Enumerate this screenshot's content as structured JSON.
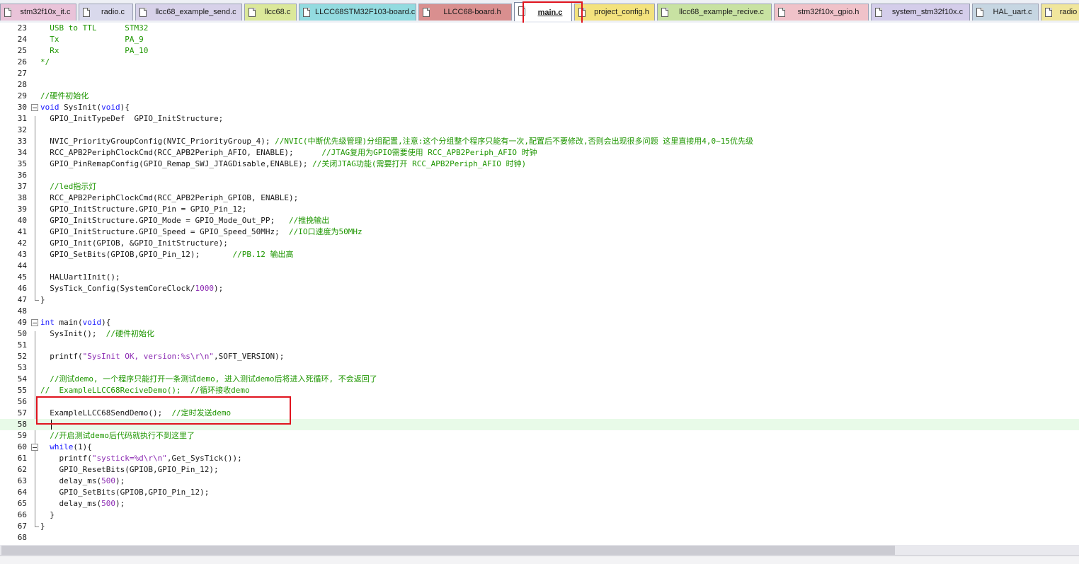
{
  "tabs": [
    {
      "label": "stm32f10x_it.c",
      "color": "#e9c3d9"
    },
    {
      "label": "radio.c",
      "color": "#d9d9ec"
    },
    {
      "label": "llcc68_example_send.c",
      "color": "#d7d1e9"
    },
    {
      "label": "llcc68.c",
      "color": "#dbe89a"
    },
    {
      "label": "LLCC68STM32F103-board.c",
      "color": "#93dbe0"
    },
    {
      "label": "LLCC68-board.h",
      "color": "#d98f8f"
    },
    {
      "label": "main.c",
      "color": "#ffffff",
      "active": true
    },
    {
      "label": "project_config.h",
      "color": "#f3e27d"
    },
    {
      "label": "llcc68_example_recive.c",
      "color": "#c8e2a2"
    },
    {
      "label": "stm32f10x_gpio.h",
      "color": "#f0c2c9"
    },
    {
      "label": "system_stm32f10x.c",
      "color": "#d4cdea"
    },
    {
      "label": "HAL_uart.c",
      "color": "#c6d6e2"
    },
    {
      "label": "radio",
      "color": "#f0e69c"
    }
  ],
  "editor": {
    "current_line": 58,
    "lines": [
      {
        "n": "23",
        "tokens": [
          {
            "t": "  USB to TTL      STM32",
            "c": "cm"
          }
        ]
      },
      {
        "n": "24",
        "tokens": [
          {
            "t": "  Tx              PA_9",
            "c": "cm"
          }
        ]
      },
      {
        "n": "25",
        "tokens": [
          {
            "t": "  Rx              PA_10",
            "c": "cm"
          }
        ]
      },
      {
        "n": "26",
        "tokens": [
          {
            "t": "*/",
            "c": "cm"
          }
        ]
      },
      {
        "n": "27",
        "tokens": []
      },
      {
        "n": "28",
        "tokens": []
      },
      {
        "n": "29",
        "tokens": [
          {
            "t": "//硬件初始化",
            "c": "cm"
          }
        ]
      },
      {
        "n": "30",
        "fold": true,
        "tokens": [
          {
            "t": "void",
            "c": "kw"
          },
          {
            "t": " SysInit(",
            "c": "tx"
          },
          {
            "t": "void",
            "c": "kw"
          },
          {
            "t": "){",
            "c": "tx"
          }
        ]
      },
      {
        "n": "31",
        "tokens": [
          {
            "t": "  GPIO_InitTypeDef  GPIO_InitStructure;",
            "c": "tx"
          }
        ]
      },
      {
        "n": "32",
        "tokens": []
      },
      {
        "n": "33",
        "tokens": [
          {
            "t": "  NVIC_PriorityGroupConfig(NVIC_PriorityGroup_4); ",
            "c": "tx"
          },
          {
            "t": "//NVIC(中断优先级管理)分组配置,注意:这个分组整个程序只能有一次,配置后不要修改,否则会出现很多问题 这里直接用4,0~15优先级",
            "c": "cm"
          }
        ]
      },
      {
        "n": "34",
        "tokens": [
          {
            "t": "  RCC_APB2PeriphClockCmd(RCC_APB2Periph_AFIO, ENABLE);      ",
            "c": "tx"
          },
          {
            "t": "//JTAG复用为GPIO需要使用 RCC_APB2Periph_AFIO 时钟",
            "c": "cm"
          }
        ]
      },
      {
        "n": "35",
        "tokens": [
          {
            "t": "  GPIO_PinRemapConfig(GPIO_Remap_SWJ_JTAGDisable,ENABLE); ",
            "c": "tx"
          },
          {
            "t": "//关闭JTAG功能(需要打开 RCC_APB2Periph_AFIO 时钟)",
            "c": "cm"
          }
        ]
      },
      {
        "n": "36",
        "tokens": []
      },
      {
        "n": "37",
        "tokens": [
          {
            "t": "  //led指示灯",
            "c": "cm"
          }
        ]
      },
      {
        "n": "38",
        "tokens": [
          {
            "t": "  RCC_APB2PeriphClockCmd(RCC_APB2Periph_GPIOB, ENABLE);",
            "c": "tx"
          }
        ]
      },
      {
        "n": "39",
        "tokens": [
          {
            "t": "  GPIO_InitStructure.GPIO_Pin = GPIO_Pin_12;",
            "c": "tx"
          }
        ]
      },
      {
        "n": "40",
        "tokens": [
          {
            "t": "  GPIO_InitStructure.GPIO_Mode = GPIO_Mode_Out_PP;   ",
            "c": "tx"
          },
          {
            "t": "//推挽输出",
            "c": "cm"
          }
        ]
      },
      {
        "n": "41",
        "tokens": [
          {
            "t": "  GPIO_InitStructure.GPIO_Speed = GPIO_Speed_50MHz;  ",
            "c": "tx"
          },
          {
            "t": "//IO口速度为50MHz",
            "c": "cm"
          }
        ]
      },
      {
        "n": "42",
        "tokens": [
          {
            "t": "  GPIO_Init(GPIOB, &GPIO_InitStructure);",
            "c": "tx"
          }
        ]
      },
      {
        "n": "43",
        "tokens": [
          {
            "t": "  GPIO_SetBits(GPIOB,GPIO_Pin_12);       ",
            "c": "tx"
          },
          {
            "t": "//PB.12 输出高",
            "c": "cm"
          }
        ]
      },
      {
        "n": "44",
        "tokens": []
      },
      {
        "n": "45",
        "tokens": [
          {
            "t": "  HALUart1Init();",
            "c": "tx"
          }
        ]
      },
      {
        "n": "46",
        "tokens": [
          {
            "t": "  SysTick_Config(SystemCoreClock/",
            "c": "tx"
          },
          {
            "t": "1000",
            "c": "nm"
          },
          {
            "t": ");",
            "c": "tx"
          }
        ]
      },
      {
        "n": "47",
        "tokens": [
          {
            "t": "}",
            "c": "tx"
          }
        ]
      },
      {
        "n": "48",
        "tokens": []
      },
      {
        "n": "49",
        "fold": true,
        "tokens": [
          {
            "t": "int",
            "c": "kw"
          },
          {
            "t": " main(",
            "c": "tx"
          },
          {
            "t": "void",
            "c": "kw"
          },
          {
            "t": "){",
            "c": "tx"
          }
        ]
      },
      {
        "n": "50",
        "tokens": [
          {
            "t": "  SysInit();  ",
            "c": "tx"
          },
          {
            "t": "//硬件初始化",
            "c": "cm"
          }
        ]
      },
      {
        "n": "51",
        "tokens": []
      },
      {
        "n": "52",
        "tokens": [
          {
            "t": "  printf(",
            "c": "tx"
          },
          {
            "t": "\"SysInit OK, version:%s\\r\\n\"",
            "c": "st"
          },
          {
            "t": ",SOFT_VERSION);",
            "c": "tx"
          }
        ]
      },
      {
        "n": "53",
        "tokens": []
      },
      {
        "n": "54",
        "tokens": [
          {
            "t": "  //测试demo, 一个程序只能打开一条测试demo, 进入测试demo后将进入死循环, 不会返回了",
            "c": "cm"
          }
        ]
      },
      {
        "n": "55",
        "tokens": [
          {
            "t": "//  ExampleLLCC68ReciveDemo();  //循环接收demo",
            "c": "cm"
          }
        ]
      },
      {
        "n": "56",
        "tokens": []
      },
      {
        "n": "57",
        "tokens": [
          {
            "t": "  ExampleLLCC68SendDemo();  ",
            "c": "tx"
          },
          {
            "t": "//定时发送demo",
            "c": "cm"
          }
        ]
      },
      {
        "n": "58",
        "tokens": []
      },
      {
        "n": "59",
        "tokens": [
          {
            "t": "  //开启测试demo后代码就执行不到这里了",
            "c": "cm"
          }
        ]
      },
      {
        "n": "60",
        "fold": true,
        "tokens": [
          {
            "t": "  ",
            "c": "tx"
          },
          {
            "t": "while",
            "c": "kw"
          },
          {
            "t": "(1){",
            "c": "tx"
          }
        ]
      },
      {
        "n": "61",
        "tokens": [
          {
            "t": "    printf(",
            "c": "tx"
          },
          {
            "t": "\"systick=%d\\r\\n\"",
            "c": "st"
          },
          {
            "t": ",Get_SysTick());",
            "c": "tx"
          }
        ]
      },
      {
        "n": "62",
        "tokens": [
          {
            "t": "    GPIO_ResetBits(GPIOB,GPIO_Pin_12);",
            "c": "tx"
          }
        ]
      },
      {
        "n": "63",
        "tokens": [
          {
            "t": "    delay_ms(",
            "c": "tx"
          },
          {
            "t": "500",
            "c": "nm"
          },
          {
            "t": ");",
            "c": "tx"
          }
        ]
      },
      {
        "n": "64",
        "tokens": [
          {
            "t": "    GPIO_SetBits(GPIOB,GPIO_Pin_12);",
            "c": "tx"
          }
        ]
      },
      {
        "n": "65",
        "tokens": [
          {
            "t": "    delay_ms(",
            "c": "tx"
          },
          {
            "t": "500",
            "c": "nm"
          },
          {
            "t": ");",
            "c": "tx"
          }
        ]
      },
      {
        "n": "66",
        "tokens": [
          {
            "t": "  }",
            "c": "tx"
          }
        ]
      },
      {
        "n": "67",
        "tokens": [
          {
            "t": "}",
            "c": "tx"
          }
        ]
      },
      {
        "n": "68",
        "tokens": []
      }
    ]
  }
}
